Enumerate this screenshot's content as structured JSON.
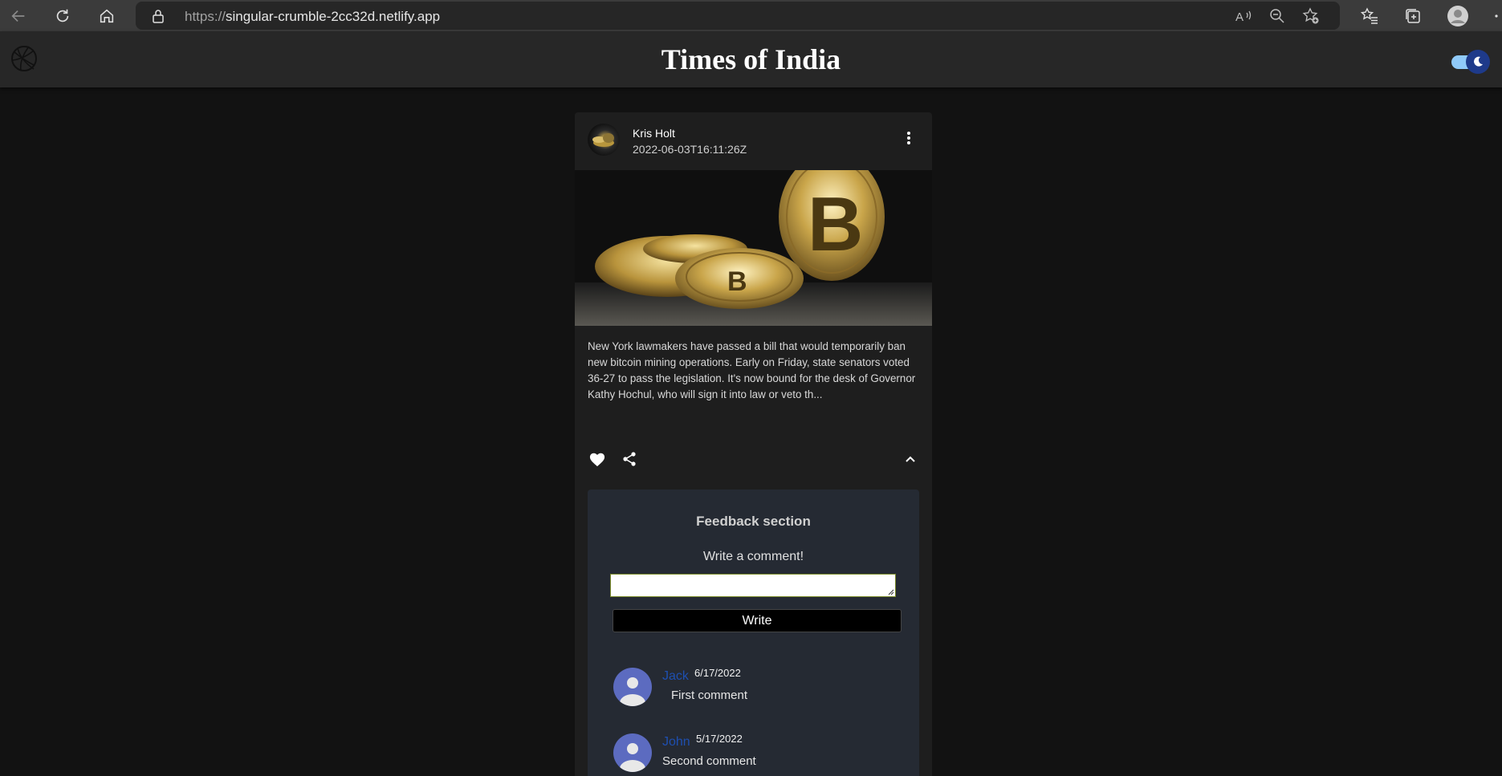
{
  "browser": {
    "url_scheme": "https://",
    "url_host": "singular-crumble-2cc32d.netlify.app"
  },
  "header": {
    "title": "Times of India"
  },
  "post": {
    "author": "Kris Holt",
    "published": "2022-06-03T16:11:26Z",
    "description": "New York lawmakers have passed a bill that would temporarily ban new bitcoin mining operations. Early on Friday, state senators voted 36-27 to pass the legislation. It's now bound for the desk of Governor Kathy Hochul, who will sign it into law or veto th..."
  },
  "feedback": {
    "title": "Feedback section",
    "prompt": "Write a comment!",
    "input_value": "",
    "button_label": "Write",
    "comments": [
      {
        "name": "Jack",
        "date": "6/17/2022",
        "text": "First comment"
      },
      {
        "name": "John",
        "date": "5/17/2022",
        "text": "Second comment"
      }
    ]
  },
  "colors": {
    "page_bg": "#121212",
    "header_bg": "#272727",
    "card_bg": "#1e1e1e",
    "feedback_bg": "#252a33",
    "comment_name": "#1e4fb0",
    "avatar_bg": "#5c6bc0",
    "toggle_track": "#90caf9",
    "toggle_thumb": "#1e3a8a"
  }
}
